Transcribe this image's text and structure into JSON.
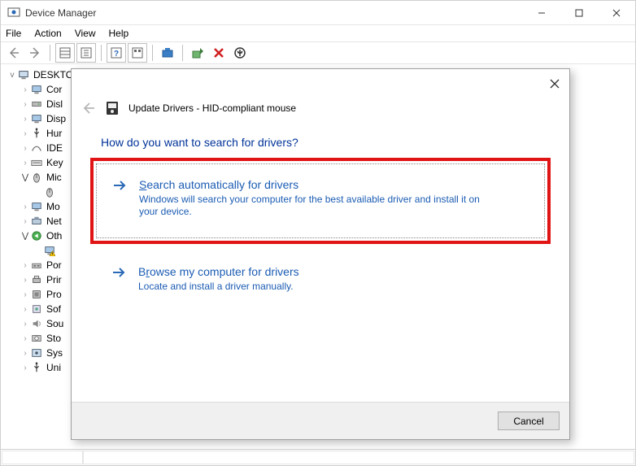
{
  "window": {
    "title": "Device Manager",
    "menu": {
      "file": "File",
      "action": "Action",
      "view": "View",
      "help": "Help"
    }
  },
  "tree": {
    "root": "DESKTO",
    "items": [
      {
        "label": "Cor",
        "twisty": ">",
        "icon": "monitor"
      },
      {
        "label": "Disl",
        "twisty": ">",
        "icon": "drive"
      },
      {
        "label": "Disp",
        "twisty": ">",
        "icon": "monitor"
      },
      {
        "label": "Hur",
        "twisty": ">",
        "icon": "usb"
      },
      {
        "label": "IDE",
        "twisty": ">",
        "icon": "cable"
      },
      {
        "label": "Key",
        "twisty": ">",
        "icon": "keyboard"
      },
      {
        "label": "Mic",
        "twisty": "v",
        "icon": "mouse",
        "child": ""
      },
      {
        "label": "Mo",
        "twisty": ">",
        "icon": "monitor"
      },
      {
        "label": "Net",
        "twisty": ">",
        "icon": "network"
      },
      {
        "label": "Oth",
        "twisty": "v",
        "icon": "warning",
        "child": ""
      },
      {
        "label": "Por",
        "twisty": ">",
        "icon": "port"
      },
      {
        "label": "Prir",
        "twisty": ">",
        "icon": "printer"
      },
      {
        "label": "Pro",
        "twisty": ">",
        "icon": "cpu"
      },
      {
        "label": "Sof",
        "twisty": ">",
        "icon": "software"
      },
      {
        "label": "Sou",
        "twisty": ">",
        "icon": "sound"
      },
      {
        "label": "Sto",
        "twisty": ">",
        "icon": "storage"
      },
      {
        "label": "Sys",
        "twisty": ">",
        "icon": "system"
      },
      {
        "label": "Uni",
        "twisty": ">",
        "icon": "usb"
      }
    ]
  },
  "dialog": {
    "title": "Update Drivers - HID-compliant mouse",
    "question": "How do you want to search for drivers?",
    "opt1_pre": "S",
    "opt1_rest": "earch automatically for drivers",
    "opt1_desc": "Windows will search your computer for the best available driver and install it on your device.",
    "opt2_pre": "B",
    "opt2_mid": "r",
    "opt2_rest": "owse my computer for drivers",
    "opt2_desc": "Locate and install a driver manually.",
    "cancel": "Cancel"
  }
}
